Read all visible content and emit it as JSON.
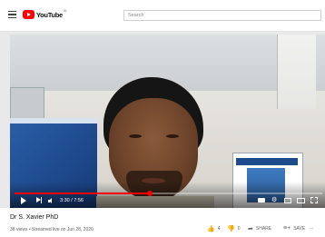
{
  "header": {
    "logo_text": "YouTube",
    "logo_region": "IN",
    "search_placeholder": "Search"
  },
  "player": {
    "time_display": "3:30 / 7:56",
    "progress_fraction": 0.441
  },
  "video_info": {
    "title": "Dr S. Xavier PhD",
    "meta": "38 views • Streamed live on Jun 28, 2020",
    "likes": "4",
    "dislikes": "0",
    "share_label": "SHARE",
    "save_label": "SAVE",
    "more_label": "..."
  },
  "colors": {
    "brand": "#ff0000",
    "progress": "#ff0000"
  },
  "icons": [
    "menu-icon",
    "youtube-logo-icon",
    "play-icon",
    "next-icon",
    "volume-icon",
    "captions-icon",
    "gear-icon",
    "miniplayer-icon",
    "theater-icon",
    "fullscreen-icon",
    "thumbs-up-icon",
    "thumbs-down-icon",
    "share-icon",
    "save-icon"
  ]
}
